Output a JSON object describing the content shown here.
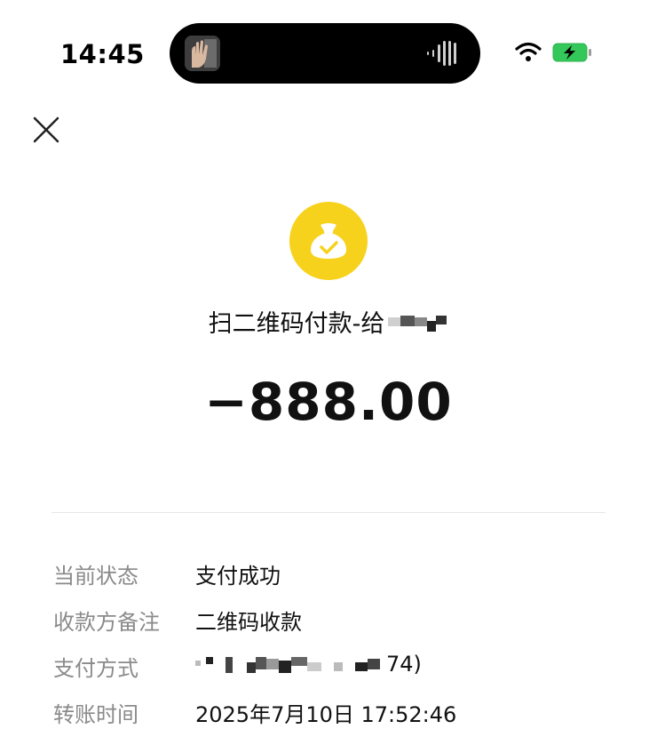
{
  "status_bar": {
    "time": "14:45",
    "wifi_icon": "wifi-icon",
    "battery_icon": "battery-charging-icon",
    "battery_color": "#34c759"
  },
  "header": {
    "close_icon": "close-icon",
    "bag_icon": "money-bag-check-icon",
    "bag_color": "#f7d21d",
    "title": "扫二维码付款-给",
    "amount": "−888.00"
  },
  "details": {
    "status": {
      "label": "当前状态",
      "value": "支付成功"
    },
    "memo": {
      "label": "收款方备注",
      "value": "二维码收款"
    },
    "method": {
      "label": "支付方式",
      "value_tail": "74)"
    },
    "time": {
      "label": "转账时间",
      "value": "2025年7月10日 17:52:46"
    }
  }
}
